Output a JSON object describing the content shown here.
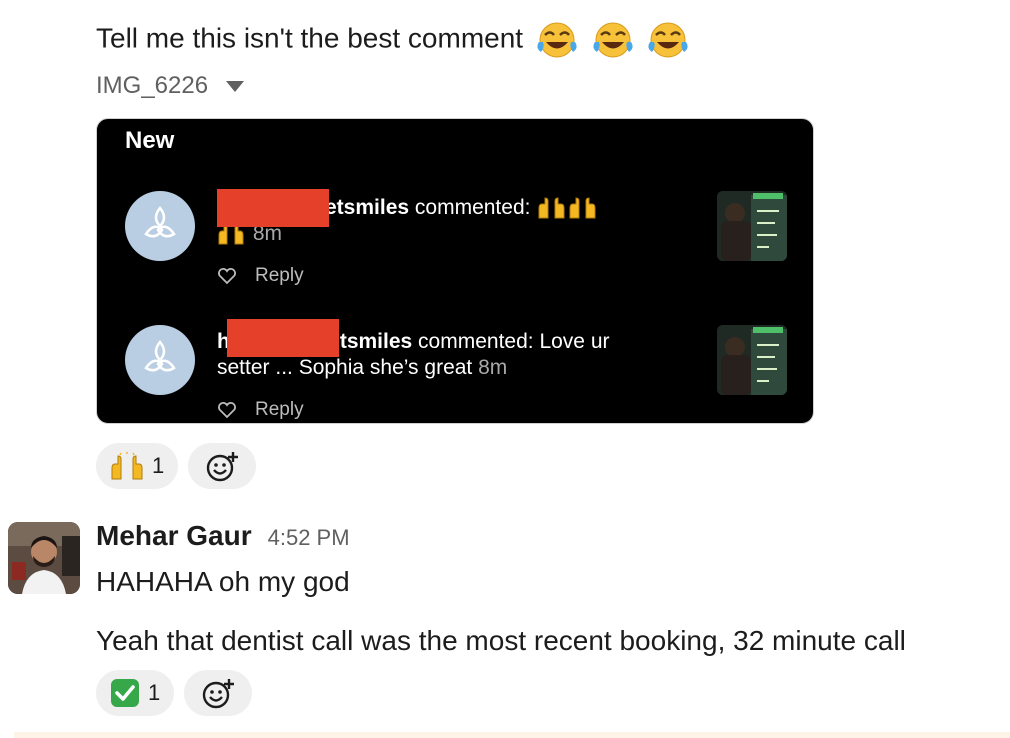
{
  "message1": {
    "text": "Tell me this isn't the best comment",
    "emoji": [
      "face-with-tears-of-joy",
      "face-with-tears-of-joy",
      "face-with-tears-of-joy"
    ],
    "attachment_name": "IMG_6226",
    "screenshot": {
      "title": "New",
      "comments": [
        {
          "username_suffix": "etsmiles",
          "action": "commented:",
          "body_emoji": "raising-hands",
          "time": "8m",
          "reply_label": "Reply"
        },
        {
          "username_prefix": "h",
          "username_suffix": "tsmiles",
          "action": "commented:",
          "body": "Love ur setter ... Sophia she’s great",
          "time": "8m",
          "reply_label": "Reply"
        }
      ]
    },
    "reactions": [
      {
        "emoji": "raising-hands",
        "count": "1"
      }
    ]
  },
  "message2": {
    "author": "Mehar Gaur",
    "time": "4:52 PM",
    "lines": [
      "HAHAHA oh my god",
      "Yeah that dentist call was the most recent booking, 32 minute call"
    ],
    "reactions": [
      {
        "emoji": "white-check-mark",
        "count": "1"
      }
    ]
  },
  "colors": {
    "redaction": "#e5402a",
    "reaction_bg": "#efefef",
    "check_green": "#37a84a"
  }
}
